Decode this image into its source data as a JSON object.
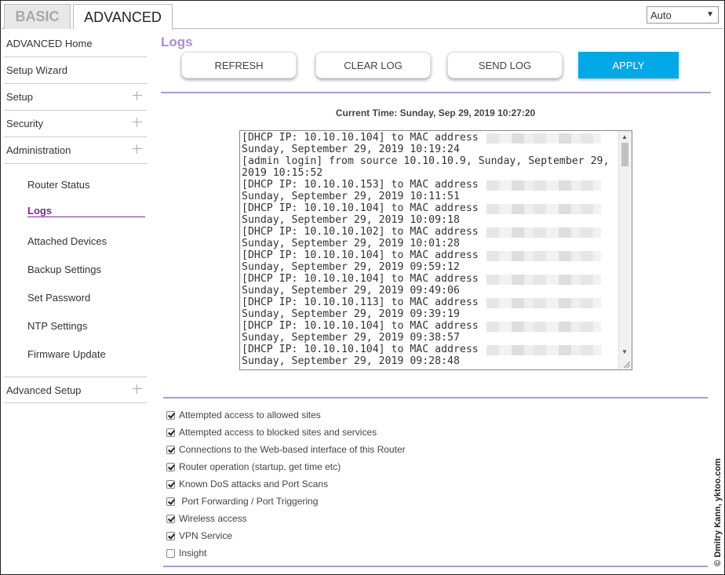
{
  "tabs": {
    "basic": "BASIC",
    "advanced": "ADVANCED"
  },
  "language_select": {
    "value": "Auto"
  },
  "sidebar": {
    "top_items": [
      {
        "label": "ADVANCED Home",
        "expandable": false
      },
      {
        "label": "Setup Wizard",
        "expandable": false
      },
      {
        "label": "Setup",
        "expandable": true
      },
      {
        "label": "Security",
        "expandable": true
      },
      {
        "label": "Administration",
        "expandable": true
      }
    ],
    "admin_subitems": [
      {
        "label": "Router Status",
        "active": false
      },
      {
        "label": "Logs",
        "active": true
      },
      {
        "label": "Attached Devices",
        "active": false
      },
      {
        "label": "Backup Settings",
        "active": false
      },
      {
        "label": "Set Password",
        "active": false
      },
      {
        "label": "NTP Settings",
        "active": false
      },
      {
        "label": "Firmware Update",
        "active": false
      }
    ],
    "bottom_item": {
      "label": "Advanced Setup",
      "expandable": true
    }
  },
  "main": {
    "title": "Logs",
    "buttons": {
      "refresh": "REFRESH",
      "clear_log": "CLEAR LOG",
      "send_log": "SEND LOG",
      "apply": "APPLY"
    },
    "current_time": "Current Time: Sunday, Sep 29, 2019 10:27:20",
    "log_lines": [
      "[DHCP IP: 10.10.10.104] to MAC address",
      "Sunday, September 29, 2019 10:19:24",
      "[admin login] from source 10.10.10.9, Sunday, September 29,",
      "2019 10:15:52",
      "[DHCP IP: 10.10.10.153] to MAC address",
      "Sunday, September 29, 2019 10:11:51",
      "[DHCP IP: 10.10.10.104] to MAC address",
      "Sunday, September 29, 2019 10:09:18",
      "[DHCP IP: 10.10.10.102] to MAC address",
      "Sunday, September 29, 2019 10:01:28",
      "[DHCP IP: 10.10.10.104] to MAC address",
      "Sunday, September 29, 2019 09:59:12",
      "[DHCP IP: 10.10.10.104] to MAC address",
      "Sunday, September 29, 2019 09:49:06",
      "[DHCP IP: 10.10.10.113] to MAC address",
      "Sunday, September 29, 2019 09:39:19",
      "[DHCP IP: 10.10.10.104] to MAC address",
      "Sunday, September 29, 2019 09:38:57",
      "[DHCP IP: 10.10.10.104] to MAC address",
      "Sunday, September 29, 2019 09:28:48"
    ],
    "log_options": [
      {
        "label": "Attempted access to allowed sites",
        "checked": true
      },
      {
        "label": "Attempted access to blocked sites and services",
        "checked": true
      },
      {
        "label": "Connections to the Web-based interface of this Router",
        "checked": true
      },
      {
        "label": "Router operation (startup, get time etc)",
        "checked": true
      },
      {
        "label": "Known DoS attacks and Port Scans",
        "checked": true
      },
      {
        "label": " Port Forwarding / Port Triggering",
        "checked": true
      },
      {
        "label": "Wireless access",
        "checked": true
      },
      {
        "label": "VPN Service",
        "checked": true
      },
      {
        "label": "Insight",
        "checked": false
      }
    ]
  },
  "watermark": "© Dmitry Kann, yktoo.com",
  "icons": {
    "expand": "plus-icon",
    "select_arrow": "chevron-down-icon",
    "check": "checkmark-icon"
  }
}
